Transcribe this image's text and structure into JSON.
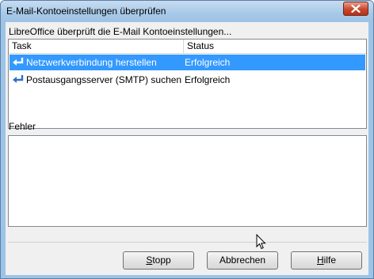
{
  "window": {
    "title": "E-Mail-Kontoeinstellungen überprüfen"
  },
  "dialog": {
    "header": "LibreOffice überprüft die E-Mail Kontoeinstellungen..."
  },
  "task_list": {
    "columns": [
      "Task",
      "Status"
    ],
    "rows": [
      {
        "task": "Netzwerkverbindung herstellen",
        "status": "Erfolgreich",
        "icon": "return-arrow-icon",
        "selected": true
      },
      {
        "task": "Postausgangsserver (SMTP) suchen",
        "status": "Erfolgreich",
        "icon": "return-arrow-icon",
        "selected": false
      }
    ]
  },
  "errors": {
    "label": "Fehler",
    "content": ""
  },
  "buttons": {
    "stop": {
      "mnemonic": "S",
      "rest": "topp"
    },
    "cancel": {
      "label": "Abbrechen"
    },
    "help": {
      "mnemonic": "H",
      "rest": "ilfe"
    }
  },
  "colors": {
    "selection": "#3399ff",
    "frame": "#9dc3e6",
    "close_button": "#c8472b"
  }
}
